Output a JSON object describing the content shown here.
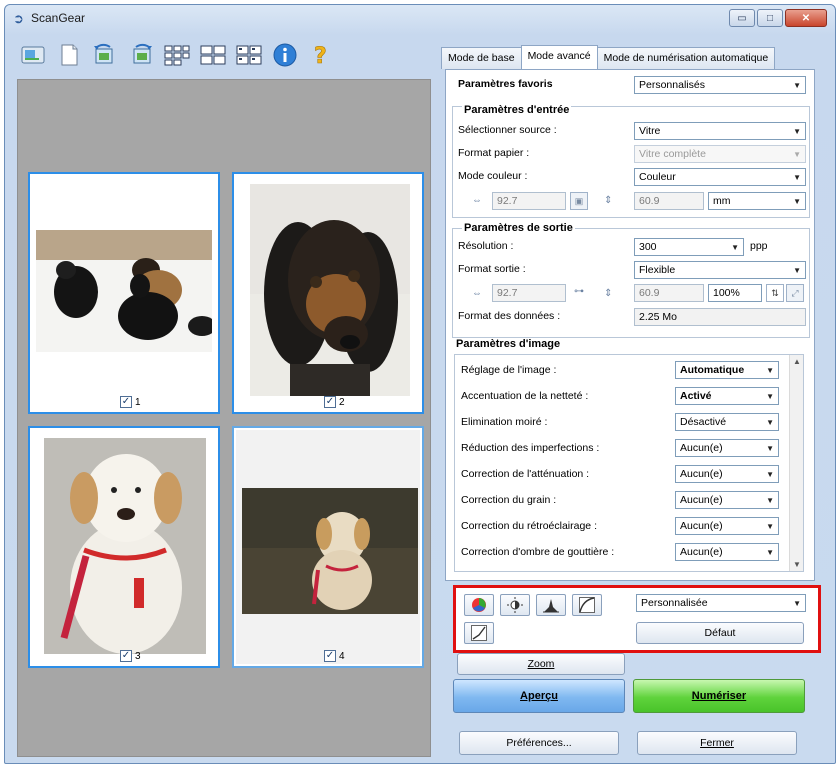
{
  "window": {
    "title": "ScanGear",
    "minimize": "▭",
    "maximize": "□",
    "close": "✕"
  },
  "toolbar": {
    "icons": [
      "scan-window-icon",
      "blank-page-icon",
      "rotate-left-icon",
      "rotate-right-icon",
      "thumbnail-grid-icon",
      "whole-image-icon",
      "multi-crop-icon",
      "info-icon",
      "help-icon"
    ]
  },
  "thumbnails": [
    {
      "label": "1"
    },
    {
      "label": "2"
    },
    {
      "label": "3"
    },
    {
      "label": "4"
    }
  ],
  "tabs": [
    "Mode de base",
    "Mode avancé",
    "Mode de numérisation automatique"
  ],
  "favorites": {
    "label": "Paramètres favoris",
    "value": "Personnalisés"
  },
  "input": {
    "title": "Paramètres d'entrée",
    "source_label": "Sélectionner source :",
    "source_value": "Vitre",
    "paper_label": "Format papier :",
    "paper_value": "Vitre complète",
    "color_label": "Mode couleur :",
    "color_value": "Couleur",
    "width": "92.7",
    "height": "60.9",
    "unit": "mm"
  },
  "output": {
    "title": "Paramètres de sortie",
    "resolution_label": "Résolution :",
    "resolution_value": "300",
    "resolution_unit": "ppp",
    "format_label": "Format sortie :",
    "format_value": "Flexible",
    "width": "92.7",
    "height": "60.9",
    "scale": "100%",
    "data_size_label": "Format des données :",
    "data_size_value": "2.25 Mo"
  },
  "image_settings": {
    "title": "Paramètres d'image",
    "rows": [
      {
        "label": "Réglage de l'image :",
        "value": "Automatique"
      },
      {
        "label": "Accentuation de la netteté :",
        "value": "Activé"
      },
      {
        "label": "Elimination moiré :",
        "value": "Désactivé"
      },
      {
        "label": "Réduction des imperfections :",
        "value": "Aucun(e)"
      },
      {
        "label": "Correction de l'atténuation :",
        "value": "Aucun(e)"
      },
      {
        "label": "Correction du grain :",
        "value": "Aucun(e)"
      },
      {
        "label": "Correction du rétroéclairage :",
        "value": "Aucun(e)"
      },
      {
        "label": "Correction d'ombre de gouttière :",
        "value": "Aucun(e)"
      }
    ]
  },
  "tone": {
    "preset": "Personnalisée",
    "default_button": "Défaut"
  },
  "buttons": {
    "zoom": "Zoom",
    "preview": "Aperçu",
    "scan": "Numériser",
    "preferences": "Préférences...",
    "close": "Fermer"
  },
  "colors": {
    "accent_blue": "#2c8ee8",
    "highlight_red": "#e01010",
    "scan_green": "#5fd33c",
    "preview_blue": "#7fb8f0"
  }
}
